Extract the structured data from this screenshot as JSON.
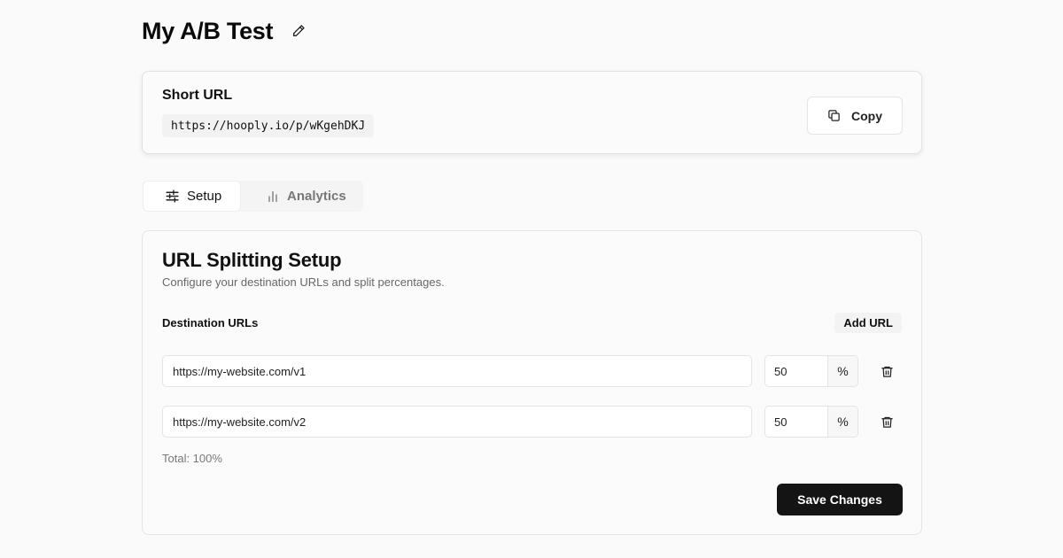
{
  "header": {
    "title": "My A/B Test",
    "edit_icon": "pencil-icon"
  },
  "short_url": {
    "label": "Short URL",
    "value": "https://hooply.io/p/wKgehDKJ",
    "copy_label": "Copy",
    "copy_icon": "copy-icon"
  },
  "tabs": [
    {
      "label": "Setup",
      "icon": "sliders-icon",
      "active": true
    },
    {
      "label": "Analytics",
      "icon": "bar-chart-icon",
      "active": false
    }
  ],
  "setup": {
    "title": "URL Splitting Setup",
    "subtitle": "Configure your destination URLs and split percentages.",
    "dest_label": "Destination URLs",
    "add_url_label": "Add URL",
    "rows": [
      {
        "url": "https://my-website.com/v1",
        "percent": "50",
        "suffix": "%"
      },
      {
        "url": "https://my-website.com/v2",
        "percent": "50",
        "suffix": "%"
      }
    ],
    "total": "Total: 100%",
    "save_label": "Save Changes"
  },
  "colors": {
    "background": "#fafafa",
    "primary_button": "#141414",
    "border": "#e4e4e4"
  }
}
